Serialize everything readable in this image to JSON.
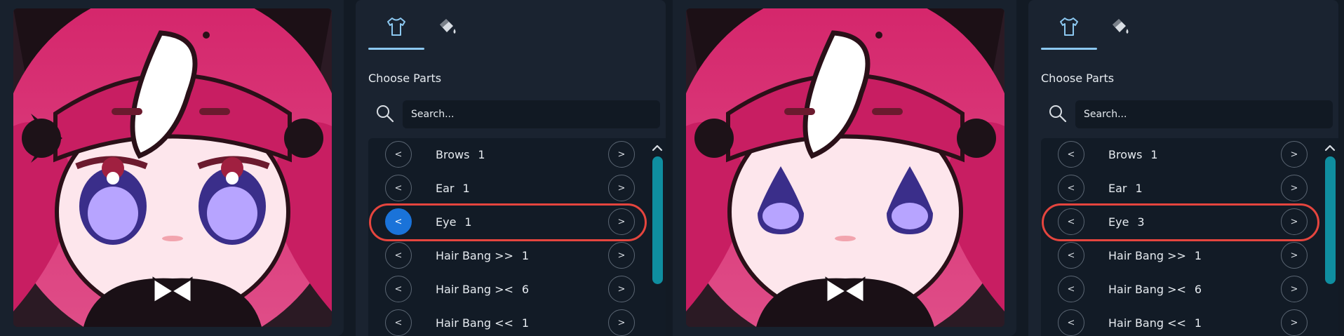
{
  "colors": {
    "background": "#121a24",
    "panel": "#1a2330",
    "accent_tab": "#8cc8f0",
    "active_button": "#1a73d9",
    "highlight": "#e5453e",
    "scrollbar": "#0f8ea0"
  },
  "views": [
    {
      "tabs": [
        {
          "name": "clothing-tab",
          "icon": "shirt-icon",
          "selected": true
        },
        {
          "name": "paint-tab",
          "icon": "paint-bucket-icon",
          "selected": false
        }
      ],
      "section_title": "Choose Parts",
      "search": {
        "placeholder": "Search...",
        "value": ""
      },
      "parts": [
        {
          "label": "Brows",
          "value": "1"
        },
        {
          "label": "Ear",
          "value": "1"
        },
        {
          "label": "Eye",
          "value": "1"
        },
        {
          "label": "Hair Bang >>",
          "value": "1"
        },
        {
          "label": "Hair Bang ><",
          "value": "6"
        },
        {
          "label": "Hair Bang <<",
          "value": "1"
        }
      ],
      "prev_label": "<",
      "next_label": ">",
      "active_prev_row": 2,
      "highlighted_row": 2,
      "avatar_eye_style": "round"
    },
    {
      "tabs": [
        {
          "name": "clothing-tab",
          "icon": "shirt-icon",
          "selected": true
        },
        {
          "name": "paint-tab",
          "icon": "paint-bucket-icon",
          "selected": false
        }
      ],
      "section_title": "Choose Parts",
      "search": {
        "placeholder": "Search...",
        "value": ""
      },
      "parts": [
        {
          "label": "Brows",
          "value": "1"
        },
        {
          "label": "Ear",
          "value": "1"
        },
        {
          "label": "Eye",
          "value": "3"
        },
        {
          "label": "Hair Bang >>",
          "value": "1"
        },
        {
          "label": "Hair Bang ><",
          "value": "6"
        },
        {
          "label": "Hair Bang <<",
          "value": "1"
        }
      ],
      "prev_label": "<",
      "next_label": ">",
      "active_prev_row": null,
      "highlighted_row": 2,
      "avatar_eye_style": "drop"
    }
  ]
}
